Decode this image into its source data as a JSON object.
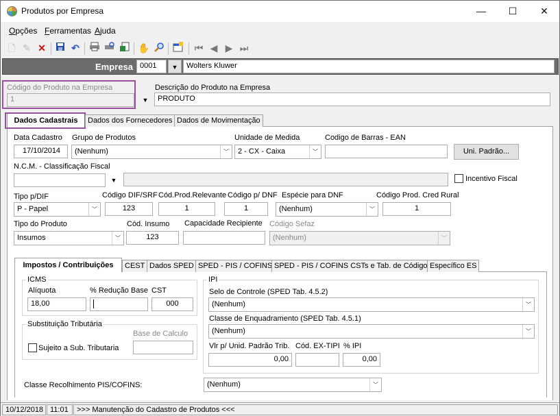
{
  "window": {
    "title": "Produtos por Empresa",
    "minimize": "—",
    "maximize": "☐",
    "close": "✕"
  },
  "menu": {
    "items": [
      "Opções",
      "Ferramentas",
      "Ajuda"
    ]
  },
  "toolbar": {
    "icons": [
      "new-icon",
      "edit-icon",
      "delete-icon",
      "save-icon",
      "undo-icon",
      "print-icon",
      "print-preview-icon",
      "export-icon",
      "hand-icon",
      "search-icon",
      "properties-icon",
      "first-icon",
      "prev-icon",
      "next-icon",
      "last-icon"
    ]
  },
  "empresa": {
    "label": "Empresa",
    "code": "0001",
    "name": "Wolters Kluwer"
  },
  "produto": {
    "code_label": "Código do Produto na Empresa",
    "code": "1",
    "desc_label": "Descrição do Produto na Empresa",
    "desc": "PRODUTO"
  },
  "tabs": [
    "Dados Cadastrais",
    "Dados dos Fornecedores",
    "Dados de Movimentação"
  ],
  "cad": {
    "data_cadastro_label": "Data Cadastro",
    "data_cadastro": "17/10/2014",
    "grupo_label": "Grupo de Produtos",
    "grupo": "(Nenhum)",
    "unidade_label": "Unidade de Medida",
    "unidade": "2 - CX - Caixa",
    "ean_label": "Codigo de Barras - EAN",
    "ean": "",
    "uni_padrao_button": "Uni. Padrão...",
    "ncm_label": "N.C.M. -  Classificação Fiscal",
    "ncm": "",
    "ncm_desc": "",
    "incentivo_label": "Incentivo Fiscal",
    "tipo_dif_label": "Tipo p/DIF",
    "tipo_dif": "P - Papel",
    "cod_dif_label": "Código DIF/SRF",
    "cod_dif": "123",
    "cod_relevante_label": "Cód.Prod.Relevante",
    "cod_relevante": "1",
    "cod_dnf_label": "Código p/ DNF",
    "cod_dnf": "1",
    "especie_label": "Espécie para DNF",
    "especie": "(Nenhum)",
    "cod_rural_label": "Código Prod. Cred Rural",
    "cod_rural": "1",
    "tipo_produto_label": "Tipo do Produto",
    "tipo_produto": "Insumos",
    "cod_insumo_label": "Cód. Insumo",
    "cod_insumo": "123",
    "capacidade_label": "Capacidade Recipiente",
    "capacidade": "",
    "sefaz_label": "Código Sefaz",
    "sefaz": "(Nenhum)"
  },
  "subtabs": [
    "Impostos / Contribuições",
    "CEST",
    "Dados SPED",
    "SPED - PIS / COFINS",
    "SPED - PIS / COFINS CSTs e Tab. de Códigos",
    "Específico ES"
  ],
  "icms": {
    "title": "ICMS",
    "aliquota_label": "Alíquota",
    "aliquota": "18,00",
    "reducao_label": "% Redução Base",
    "reducao": "",
    "cst_label": "CST",
    "cst": "000"
  },
  "st": {
    "title": "Substituição Tributária",
    "base_label": "Base de Calculo",
    "base": "",
    "sujeito_label": "Sujeito a Sub. Tributaria"
  },
  "ipi": {
    "title": "IPI",
    "selo_label": "Selo de Controle (SPED Tab. 4.5.2)",
    "selo": "(Nenhum)",
    "classe_label": "Classe de Enquadramento (SPED Tab. 4.5.1)",
    "classe": "(Nenhum)",
    "vlr_label": "Vlr p/ Unid. Padrão Trib.",
    "vlr": "0,00",
    "ex_tipi_label": "Cód. EX-TIPI",
    "ex_tipi": "",
    "pct_label": "% IPI",
    "pct": "0,00"
  },
  "pis": {
    "label": "Classe Recolhimento PIS/COFINS:",
    "value": "(Nenhum)"
  },
  "status": {
    "date": "10/12/2018",
    "time": "11:01",
    "message": ">>> Manutenção do Cadastro de Produtos <<<"
  },
  "colors": {
    "highlight": "#9b4fa0",
    "empresa_bar": "#6c6c6c"
  }
}
